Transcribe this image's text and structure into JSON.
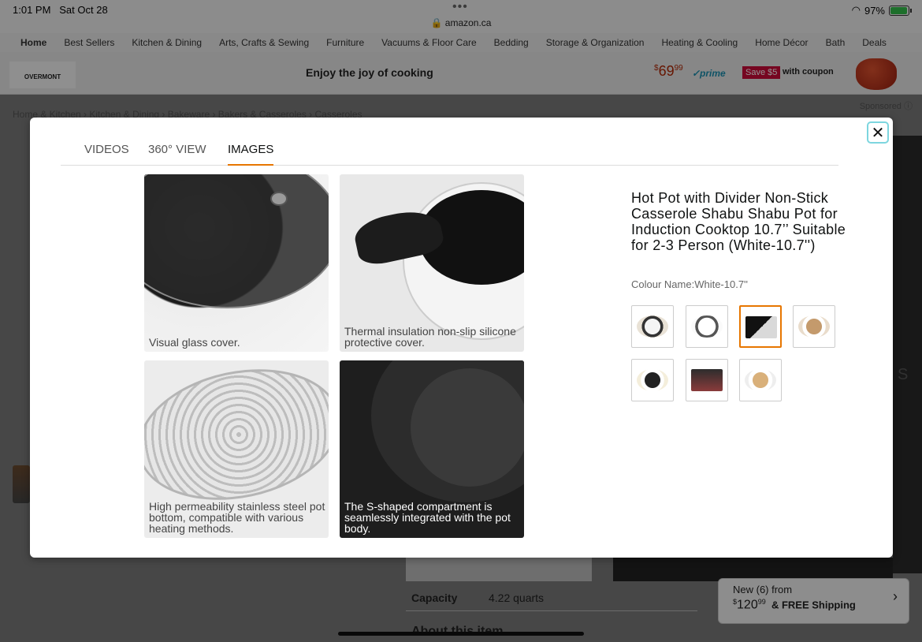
{
  "status_bar": {
    "time": "1:01 PM",
    "date": "Sat Oct 28",
    "url": "amazon.ca",
    "battery": "97%"
  },
  "category_nav": [
    "Home",
    "Best Sellers",
    "Kitchen & Dining",
    "Arts, Crafts & Sewing",
    "Furniture",
    "Vacuums & Floor Care",
    "Bedding",
    "Storage & Organization",
    "Heating & Cooling",
    "Home Décor",
    "Bath",
    "Deals"
  ],
  "ad_banner": {
    "brand": "OVERMONT",
    "tagline": "Enjoy the joy of cooking",
    "price_currency": "$",
    "price_whole": "69",
    "price_fraction": "99",
    "prime": "✓prime",
    "save_badge": "Save $5",
    "coupon_text": "with coupon",
    "sponsored": "Sponsored"
  },
  "breadcrumb": "Home & Kitchen › Kitchen & Dining › Bakeware › Bakers & Casseroles › Casseroles",
  "background": {
    "capacity_label": "Capacity",
    "capacity_value": "4.22 quarts",
    "about_heading": "About this item",
    "new_offers": "New (6) from",
    "new_price_currency": "$",
    "new_price_whole": "120",
    "new_price_fraction": "99",
    "shipping": "& FREE Shipping"
  },
  "modal": {
    "tabs": [
      "VIDEOS",
      "360° VIEW",
      "IMAGES"
    ],
    "active_tab": "IMAGES",
    "images": [
      {
        "caption": "Visual glass cover."
      },
      {
        "caption": "Thermal insulation non-slip silicone protective cover."
      },
      {
        "caption": "High permeability stainless steel pot bottom, compatible with various heating methods."
      },
      {
        "caption": "The S-shaped compartment is seamlessly integrated with the pot body."
      }
    ],
    "product_title": "Hot Pot with Divider Non-Stick Casserole Shabu Shabu Pot for Induction Cooktop 10.7’’ Suitable for 2-3 Person (White-10.7'')",
    "colour_name": "Colour Name:White-10.7''",
    "thumbnail_count": 7,
    "selected_thumbnail": 3
  }
}
